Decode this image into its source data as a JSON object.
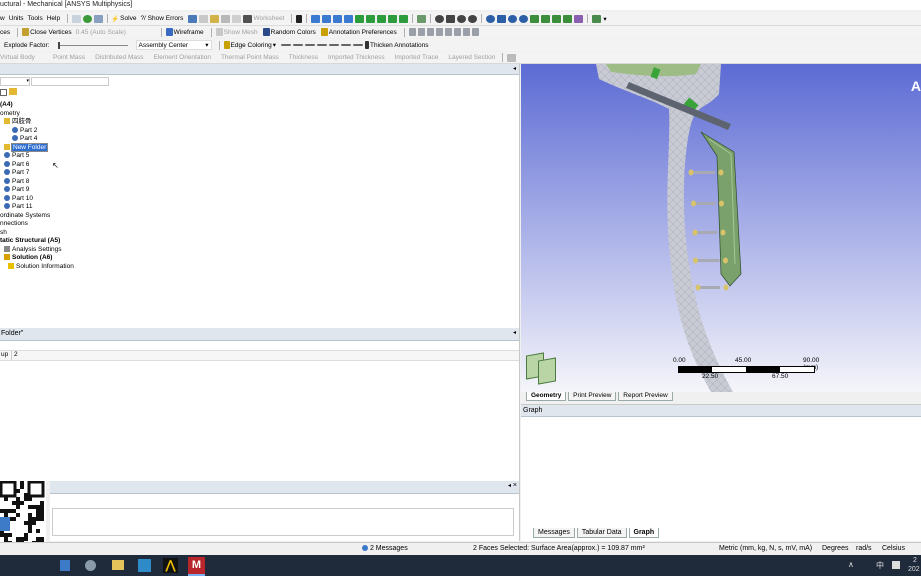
{
  "window": {
    "title": "uctural - Mechanical [ANSYS Multiphysics]"
  },
  "menu": [
    "w",
    "Units",
    "Tools",
    "Help"
  ],
  "toolbar1": {
    "solve": "Solve",
    "show_errors": "?/ Show Errors",
    "worksheet": "Worksheet"
  },
  "toolbar2": {
    "ces": "ces",
    "close_vertices": "Close Vertices",
    "auto_scale": "0.45 (Auto Scale)",
    "wireframe": "Wireframe",
    "show_mesh": "Show Mesh",
    "random_colors": "Random Colors",
    "annotation_preferences": "Annotation Preferences"
  },
  "toolbar3": {
    "explode_factor": "Explode Factor:",
    "assembly_center": "Assembly Center",
    "edge_coloring": "Edge Coloring",
    "thicken_annotations": "Thicken Annotations"
  },
  "toolbar4": [
    "Virtual Body",
    "Point Mass",
    "Distributed Mass",
    "Element Orientation",
    "Thermal Point Mass",
    "Thickness",
    "Imported Thickness",
    "Imported Trace",
    "Layered Section"
  ],
  "tree": [
    {
      "label": "(A4)",
      "indent": 0,
      "icon": "none",
      "bold": true
    },
    {
      "label": "ometry",
      "indent": 0,
      "icon": "none",
      "bold": false
    },
    {
      "label": "四肢骨",
      "indent": 1,
      "icon": "folder",
      "bold": false
    },
    {
      "label": "Part 2",
      "indent": 3,
      "icon": "part",
      "bold": false
    },
    {
      "label": "Part 4",
      "indent": 3,
      "icon": "part",
      "bold": false
    },
    {
      "label": "New Folder",
      "indent": 1,
      "icon": "folder",
      "bold": false,
      "selected": true
    },
    {
      "label": "Part 5",
      "indent": 1,
      "icon": "part",
      "bold": false
    },
    {
      "label": "Part 6",
      "indent": 1,
      "icon": "part",
      "bold": false
    },
    {
      "label": "Part 7",
      "indent": 1,
      "icon": "part",
      "bold": false
    },
    {
      "label": "Part 8",
      "indent": 1,
      "icon": "part",
      "bold": false
    },
    {
      "label": "Part 9",
      "indent": 1,
      "icon": "part",
      "bold": false
    },
    {
      "label": "Part 10",
      "indent": 1,
      "icon": "part",
      "bold": false
    },
    {
      "label": "Part 11",
      "indent": 1,
      "icon": "part",
      "bold": false
    },
    {
      "label": "ordinate Systems",
      "indent": 0,
      "icon": "none",
      "bold": false
    },
    {
      "label": "nnections",
      "indent": 0,
      "icon": "none",
      "bold": false
    },
    {
      "label": "sh",
      "indent": 0,
      "icon": "none",
      "bold": false
    },
    {
      "label": "tatic Structural (A5)",
      "indent": 0,
      "icon": "none",
      "bold": true
    },
    {
      "label": "Analysis Settings",
      "indent": 1,
      "icon": "settings",
      "bold": false
    },
    {
      "label": "Solution (A6)",
      "indent": 1,
      "icon": "solution",
      "bold": true
    },
    {
      "label": "Solution Information",
      "indent": 2,
      "icon": "info",
      "bold": false
    }
  ],
  "details": {
    "title": "Folder\"",
    "row_key": "up",
    "row_value": "2"
  },
  "viewport": {
    "corner_letter": "A",
    "scale": {
      "labels_top": [
        "0.00",
        "45.00",
        "90.00 (mm)"
      ],
      "labels_bottom": [
        "22.50",
        "67.50"
      ]
    },
    "tabs": [
      "Geometry",
      "Print Preview",
      "Report Preview"
    ],
    "active_tab": "Geometry",
    "colors": {
      "bg_top": "#5c6bd4",
      "bg_bottom": "#f5f5fa",
      "bone": "#c9cbd4",
      "plate": "#7aa06b",
      "screw": "#d8c36a"
    }
  },
  "graph": {
    "title": "Graph",
    "tabs": [
      "Messages",
      "Tabular Data",
      "Graph"
    ],
    "active_tab": "Graph"
  },
  "statusbar": {
    "messages": "2 Messages",
    "selection": "2 Faces Selected: Surface Area(approx.) = 109.87 mm²",
    "units": "Metric (mm, kg, N, s, mV, mA)",
    "degrees": "Degrees",
    "rads": "rad/s",
    "celsius": "Celsius"
  },
  "taskbar": {
    "tray_time": "2",
    "tray_date": "202",
    "ime": "中",
    "colors": {
      "bg": "#1f2a3a"
    }
  }
}
